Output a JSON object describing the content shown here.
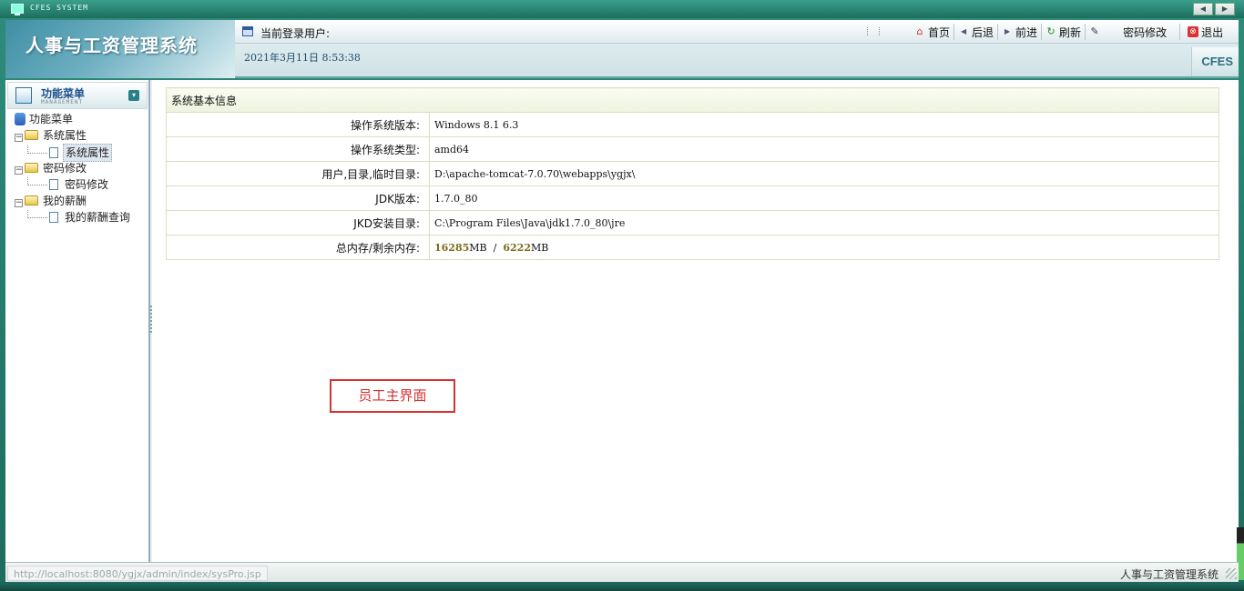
{
  "window": {
    "title": "CFES SYSTEM"
  },
  "header": {
    "brand_title": "人事与工资管理系统",
    "user_label": "当前登录用户:",
    "datetime": "2021年3月11日 8:53:38",
    "badge": "CFES",
    "toolbar": [
      {
        "label": "首页",
        "icon": "home-icon"
      },
      {
        "label": "后退",
        "icon": "back-icon"
      },
      {
        "label": "前进",
        "icon": "forward-icon"
      },
      {
        "label": "刷新",
        "icon": "refresh-icon"
      },
      {
        "label": "密码修改",
        "icon": "edit-icon"
      },
      {
        "label": "退出",
        "icon": "exit-icon"
      }
    ]
  },
  "sidebar": {
    "title": "功能菜单",
    "subtitle": "MANAGEMENT",
    "tree": {
      "root": "功能菜单",
      "groups": [
        {
          "label": "系统属性",
          "children": [
            "系统属性"
          ]
        },
        {
          "label": "密码修改",
          "children": [
            "密码修改"
          ]
        },
        {
          "label": "我的薪酬",
          "children": [
            "我的薪酬查询"
          ]
        }
      ],
      "selected": "系统属性"
    }
  },
  "main": {
    "table_title": "系统基本信息",
    "rows": [
      {
        "key": "操作系统版本:",
        "value": "Windows 8.1  6.3"
      },
      {
        "key": "操作系统类型:",
        "value": "amd64"
      },
      {
        "key": "用户,目录,临时目录:",
        "value": "D:\\apache-tomcat-7.0.70\\webapps\\ygjx\\"
      },
      {
        "key": "JDK版本:",
        "value": "1.7.0_80"
      },
      {
        "key": "JKD安装目录:",
        "value": "C:\\Program Files\\Java\\jdk1.7.0_80\\jre"
      }
    ],
    "memory": {
      "key": "总内存/剩余内存:",
      "total": "16285",
      "free": "6222",
      "unit": "MB",
      "separator": "/"
    },
    "annotation": "员工主界面"
  },
  "status": {
    "url": "http://localhost:8080/ygjx/admin/index/sysPro.jsp",
    "right": "人事与工资管理系统"
  },
  "colors": {
    "frame": "#1f6b5e",
    "annotation": "#d93030",
    "memory_value": "#7a6c1a"
  }
}
